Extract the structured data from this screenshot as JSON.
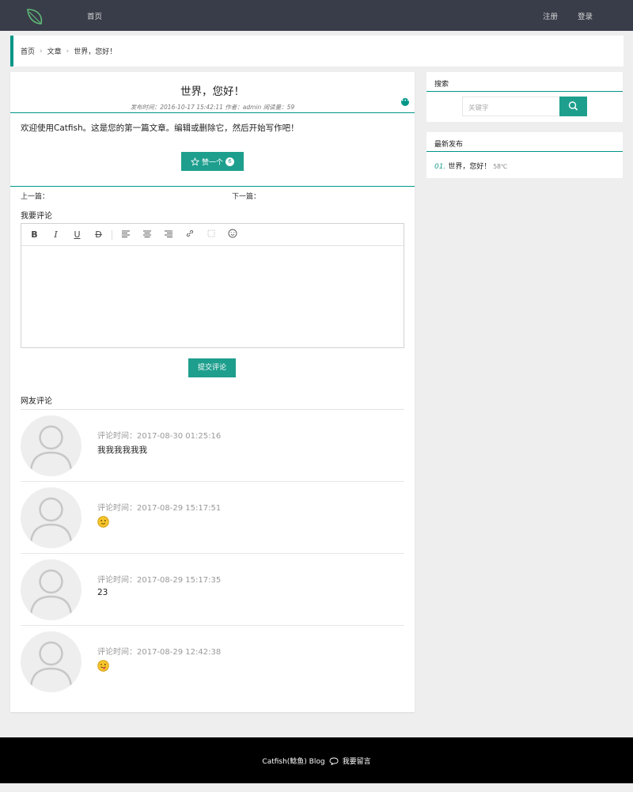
{
  "nav": {
    "home": "首页",
    "register": "注册",
    "login": "登录"
  },
  "breadcrumb": [
    "首页",
    "文章",
    "世界，您好！"
  ],
  "article": {
    "title": "世界，您好！",
    "meta": "发布时间：2016-10-17 15:42:11 作者：admin 阅读量：59",
    "body": "欢迎使用Catfish。这是您的第一篇文章。编辑或删除它，然后开始写作吧！",
    "like_label": "赞一个",
    "like_count": "6",
    "prev_label": "上一篇：",
    "next_label": "下一篇："
  },
  "comment_form": {
    "label": "我要评论",
    "toolbar": [
      "bold",
      "italic",
      "underline",
      "strikethrough",
      "align-left",
      "align-center",
      "align-right",
      "link",
      "image",
      "emoji"
    ],
    "submit_label": "提交评论"
  },
  "comments": {
    "label": "网友评论",
    "items": [
      {
        "time": "评论时间：2017-08-30 01:25:16",
        "text": "我我我我我我"
      },
      {
        "time": "评论时间：2017-08-29 15:17:51",
        "text": "",
        "emoji": "smile-emoji"
      },
      {
        "time": "评论时间：2017-08-29 15:17:35",
        "text": "23"
      },
      {
        "time": "评论时间：2017-08-29 12:42:38",
        "text": "",
        "emoji": "tongue-emoji"
      }
    ]
  },
  "sidebar": {
    "search_title": "搜索",
    "search_placeholder": "关键字",
    "recent_title": "最新发布",
    "recent": [
      {
        "num": "01.",
        "title": "世界，您好！",
        "views": "58℃"
      }
    ]
  },
  "footer": {
    "text": "Catfish(鲶鱼) Blog",
    "message_link": "我要留言"
  },
  "colors": {
    "accent": "#009688",
    "topbar": "#393d49"
  }
}
